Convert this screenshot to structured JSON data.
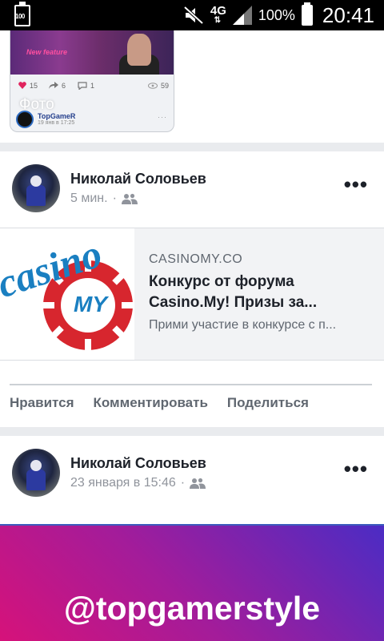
{
  "status_bar": {
    "battery_small_label": "100",
    "network": "4G",
    "battery_percent": "100%",
    "time": "20:41"
  },
  "top_card": {
    "photo_label": "Фото",
    "image_overlay_text": "New feature",
    "likes": "15",
    "shares": "6",
    "comments": "1",
    "views": "59",
    "page_name": "TopGameR",
    "date": "19 янв в 17:25"
  },
  "posts": [
    {
      "author": "Николай Соловьев",
      "time": "5 мин.",
      "link": {
        "domain": "CASINOMY.CO",
        "title": "Конкурс от форума Casino.My! Призы за...",
        "description": "Прими участие в конкурсе с п...",
        "logo_word": "casino",
        "logo_chip_text": "MY"
      },
      "actions": {
        "like": "Нравится",
        "comment": "Комментировать",
        "share": "Поделиться"
      }
    },
    {
      "author": "Николай Соловьев",
      "time": "23 января в 15:46"
    }
  ],
  "banner": {
    "handle": "@topgamerstyle"
  },
  "colors": {
    "link_blue": "#1a7fc1",
    "chip_red": "#d7262e",
    "banner_start": "#d6127a",
    "banner_end": "#4b2cc4"
  }
}
